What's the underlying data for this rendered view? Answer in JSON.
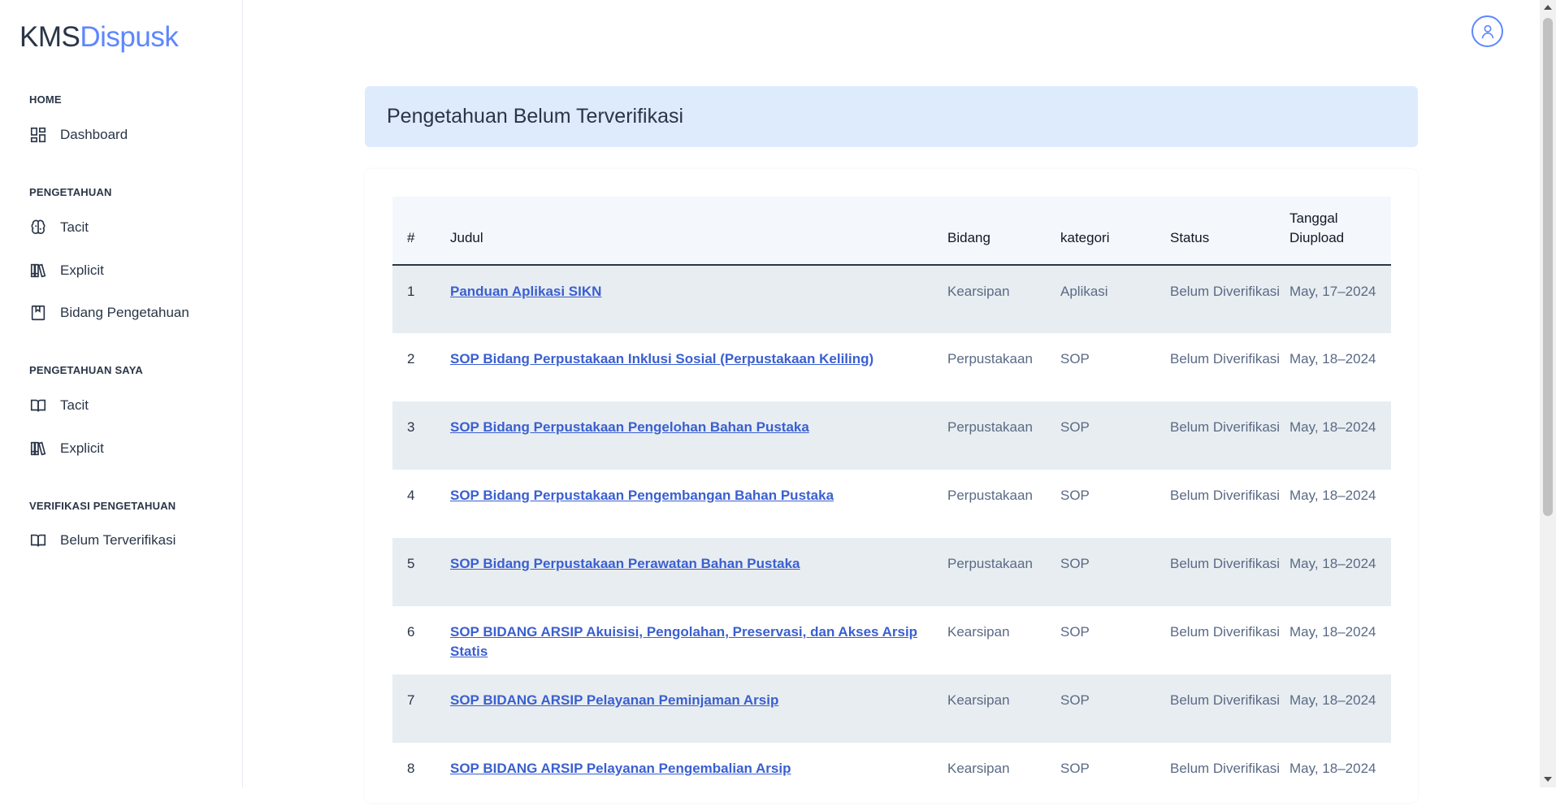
{
  "brand": {
    "part1": "KMS",
    "part2": "Dispusk"
  },
  "sidebar": {
    "sections": [
      {
        "title": "HOME",
        "items": [
          {
            "label": "Dashboard",
            "icon": "dashboard-icon"
          }
        ]
      },
      {
        "title": "PENGETAHUAN",
        "items": [
          {
            "label": "Tacit",
            "icon": "brain-icon"
          },
          {
            "label": "Explicit",
            "icon": "books-icon"
          },
          {
            "label": "Bidang Pengetahuan",
            "icon": "bookmark-icon"
          }
        ]
      },
      {
        "title": "PENGETAHUAN SAYA",
        "items": [
          {
            "label": "Tacit",
            "icon": "open-book-icon"
          },
          {
            "label": "Explicit",
            "icon": "books-icon"
          }
        ]
      },
      {
        "title": "VERIFIKASI PENGETAHUAN",
        "items": [
          {
            "label": "Belum Terverifikasi",
            "icon": "open-book-icon"
          }
        ]
      }
    ]
  },
  "page": {
    "title": "Pengetahuan Belum Terverifikasi"
  },
  "table": {
    "headers": {
      "num": "#",
      "judul": "Judul",
      "bidang": "Bidang",
      "kategori": "kategori",
      "status": "Status",
      "tanggal": "Tanggal Diupload"
    },
    "rows": [
      {
        "num": "1",
        "judul": "Panduan Aplikasi SIKN",
        "bidang": "Kearsipan",
        "kategori": "Aplikasi",
        "status": "Belum Diverifikasi",
        "tanggal": "May, 17–2024"
      },
      {
        "num": "2",
        "judul": "SOP Bidang Perpustakaan Inklusi Sosial (Perpustakaan Keliling)",
        "bidang": "Perpustakaan",
        "kategori": "SOP",
        "status": "Belum Diverifikasi",
        "tanggal": "May, 18–2024"
      },
      {
        "num": "3",
        "judul": "SOP Bidang Perpustakaan Pengelohan Bahan Pustaka",
        "bidang": "Perpustakaan",
        "kategori": "SOP",
        "status": "Belum Diverifikasi",
        "tanggal": "May, 18–2024"
      },
      {
        "num": "4",
        "judul": "SOP Bidang Perpustakaan Pengembangan Bahan Pustaka",
        "bidang": "Perpustakaan",
        "kategori": "SOP",
        "status": "Belum Diverifikasi",
        "tanggal": "May, 18–2024"
      },
      {
        "num": "5",
        "judul": "SOP Bidang Perpustakaan Perawatan Bahan Pustaka",
        "bidang": "Perpustakaan",
        "kategori": "SOP",
        "status": "Belum Diverifikasi",
        "tanggal": "May, 18–2024"
      },
      {
        "num": "6",
        "judul": "SOP BIDANG ARSIP Akuisisi, Pengolahan, Preservasi, dan Akses Arsip Statis",
        "bidang": "Kearsipan",
        "kategori": "SOP",
        "status": "Belum Diverifikasi",
        "tanggal": "May, 18–2024"
      },
      {
        "num": "7",
        "judul": "SOP BIDANG ARSIP Pelayanan Peminjaman Arsip",
        "bidang": "Kearsipan",
        "kategori": "SOP",
        "status": "Belum Diverifikasi",
        "tanggal": "May, 18–2024"
      },
      {
        "num": "8",
        "judul": "SOP BIDANG ARSIP Pelayanan Pengembalian Arsip",
        "bidang": "Kearsipan",
        "kategori": "SOP",
        "status": "Belum Diverifikasi",
        "tanggal": "May, 18–2024"
      }
    ]
  },
  "colors": {
    "accent": "#5d87ff",
    "banner_bg": "#deebfd",
    "link": "#3a5fd0",
    "row_alt": "#e8edf1"
  }
}
